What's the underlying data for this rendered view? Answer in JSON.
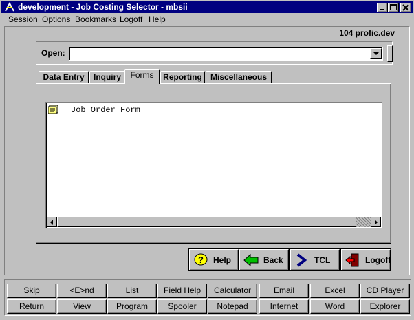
{
  "window": {
    "title": "development - Job Costing Selector - mbsii",
    "min_label": "minimize",
    "max_label": "maximize",
    "close_label": "close"
  },
  "menu": [
    "Session",
    "Options",
    "Bookmarks",
    "Logoff",
    "Help"
  ],
  "account_label": "104 profic.dev",
  "open": {
    "label": "Open:",
    "value": ""
  },
  "tabs": [
    "Data Entry",
    "Inquiry",
    "Forms",
    "Reporting",
    "Miscellaneous"
  ],
  "active_tab": "Forms",
  "list": [
    {
      "label": "Job Order Form",
      "icon": "form-document-icon"
    }
  ],
  "actions": [
    {
      "label": "Help",
      "icon": "question-mark-icon"
    },
    {
      "label": "Back",
      "icon": "back-arrow-icon"
    },
    {
      "label": "TCL",
      "icon": "chevron-right-icon"
    },
    {
      "label": "Logoff",
      "icon": "exit-door-icon"
    }
  ],
  "function_keys": {
    "row1": [
      "Skip",
      "<E>nd",
      "List",
      "Field Help",
      "Calculator",
      "Email",
      "Excel",
      "CD Player"
    ],
    "row2": [
      "Return",
      "View",
      "Program",
      "Spooler",
      "Notepad",
      "Internet",
      "Word",
      "Explorer"
    ]
  },
  "colors": {
    "titlebar": "#000080",
    "face": "#c0c0c0",
    "back_arrow": "#00c000",
    "tcl_chevron": "#000080",
    "help_icon": "#ffff00",
    "logoff_icon": "#c00000"
  }
}
